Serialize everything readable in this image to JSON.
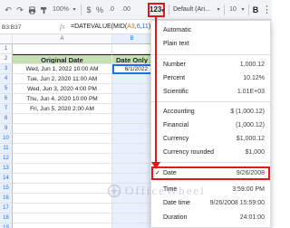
{
  "toolbar": {
    "undo_icon": "undo-icon",
    "redo_icon": "redo-icon",
    "print_icon": "print-icon",
    "paint_icon": "paint-format-icon",
    "zoom": "100%",
    "currency": "$",
    "percent": "%",
    "dec_decrease": ".0",
    "dec_increase": ".00",
    "more_formats": "123",
    "font": "Default (Ari...",
    "font_size": "10",
    "bold": "B",
    "more": "⋮"
  },
  "formula_bar": {
    "name_box": "B3:B37",
    "fx": "fx",
    "formula_prefix": "=DATEVALUE(MID(",
    "formula_ref": "A3",
    "formula_mid": ",",
    "formula_n1": "6",
    "formula_sep": ",",
    "formula_n2": "11",
    "formula_suffix": "))"
  },
  "columns": [
    "A",
    "B"
  ],
  "rows": [
    "1",
    "2",
    "3",
    "4",
    "5",
    "6",
    "7",
    "8",
    "9",
    "10",
    "11",
    "12",
    "13",
    "14",
    "15",
    "16",
    "17",
    "18",
    "19"
  ],
  "table": {
    "header_original": "Original Date",
    "header_date": "Date Only",
    "rows": [
      {
        "original": "Wed, Jun 1, 2022 10:00 AM",
        "date": "6/1/2022"
      },
      {
        "original": "Tue, Jun 2, 2020 11:00 AM",
        "date": ""
      },
      {
        "original": "Wed, Jun 3, 2020 4:00 PM",
        "date": ""
      },
      {
        "original": "Thu, Jun 4, 2020 10:00 PM",
        "date": ""
      },
      {
        "original": "Fri, Jun 5, 2020 2:00 AM",
        "date": ""
      }
    ]
  },
  "menu": {
    "items": [
      {
        "label": "Automatic",
        "example": ""
      },
      {
        "label": "Plain text",
        "example": ""
      },
      {
        "label": "Number",
        "example": "1,000.12"
      },
      {
        "label": "Percent",
        "example": "10.12%"
      },
      {
        "label": "Scientific",
        "example": "1.01E+03"
      },
      {
        "label": "Accounting",
        "example": "$ (1,000.12)"
      },
      {
        "label": "Financial",
        "example": "(1,000.12)"
      },
      {
        "label": "Currency",
        "example": "$1,000.12"
      },
      {
        "label": "Currency rounded",
        "example": "$1,000"
      },
      {
        "label": "Date",
        "example": "9/26/2008",
        "checked": "✓"
      },
      {
        "label": "Time",
        "example": "3:59:00 PM"
      },
      {
        "label": "Date time",
        "example": "9/26/2008 15:59:00"
      },
      {
        "label": "Duration",
        "example": "24:01:00"
      }
    ]
  },
  "watermark": "OfficeWheel",
  "colors": {
    "highlight": "#e0191d",
    "header_fill": "#c6e0b4",
    "selection": "#e8f0fe"
  }
}
